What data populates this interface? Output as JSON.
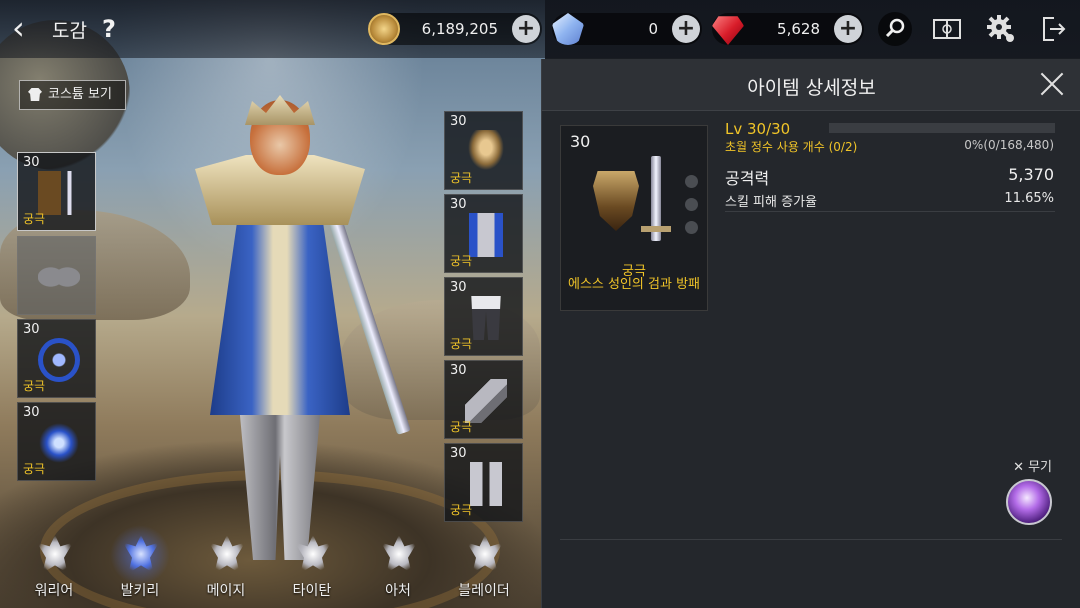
{
  "header": {
    "title": "도감",
    "help": "?",
    "back_icon": "chevron-left-icon"
  },
  "currencies": [
    {
      "icon": "gold-coin-icon",
      "amount": "6,189,205"
    },
    {
      "icon": "blue-crystal-icon",
      "amount": "0"
    },
    {
      "icon": "red-ruby-icon",
      "amount": "5,628"
    }
  ],
  "top_icons": [
    "search-icon",
    "book-icon",
    "gear-icon",
    "exit-icon"
  ],
  "costume_button": {
    "label": "코스튬 보기",
    "icon": "shirt-icon"
  },
  "left_slots": [
    {
      "level": "30",
      "grade": "궁극",
      "item": "sword-and-shield"
    },
    {
      "level": "",
      "grade": "",
      "item": "wings-empty"
    },
    {
      "level": "30",
      "grade": "궁극",
      "item": "ring"
    },
    {
      "level": "30",
      "grade": "궁극",
      "item": "blue-ornament"
    }
  ],
  "right_slots": [
    {
      "level": "30",
      "grade": "궁극",
      "item": "helmet"
    },
    {
      "level": "30",
      "grade": "궁극",
      "item": "chest-armor"
    },
    {
      "level": "30",
      "grade": "궁극",
      "item": "leggings"
    },
    {
      "level": "30",
      "grade": "궁극",
      "item": "gauntlets"
    },
    {
      "level": "30",
      "grade": "궁극",
      "item": "greaves"
    }
  ],
  "classes": [
    {
      "label": "워리어",
      "active": false
    },
    {
      "label": "발키리",
      "active": true
    },
    {
      "label": "메이지",
      "active": false
    },
    {
      "label": "타이탄",
      "active": false
    },
    {
      "label": "아처",
      "active": false
    },
    {
      "label": "블레이더",
      "active": false
    }
  ],
  "detail": {
    "title": "아이템 상세정보",
    "item": {
      "level": "30",
      "grade": "궁극",
      "name": "에스스 성인의 검과 방패"
    },
    "level_text": "Lv 30/30",
    "exp_fraction": 0,
    "essence_text": "초월 정수 사용 개수 (0/2)",
    "exp_text": "0%(0/168,480)",
    "stats": [
      {
        "name": "공격력",
        "value": "5,370"
      },
      {
        "name": "스킬 피해 증가율",
        "value": "11.65%"
      }
    ],
    "weapon_label": "무기",
    "weapon_icon": "crossed-swords-icon"
  },
  "colors": {
    "grade_gold": "#f0c428",
    "panel_bg": "#24272c"
  }
}
